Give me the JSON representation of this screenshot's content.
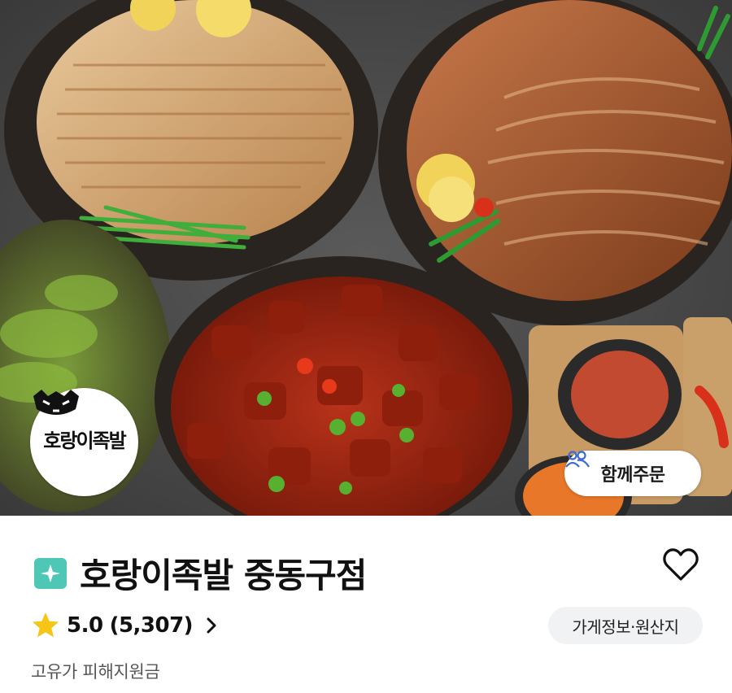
{
  "hero": {
    "logo_text": "호랑이족발",
    "group_order_label": "함께주문"
  },
  "store": {
    "name": "호랑이족발 중동구점",
    "rating": "5.0",
    "review_count": "(5,307)",
    "info_button_label": "가게정보·원산지",
    "subsidy_label": "고유가 피해지원금"
  },
  "icons": {
    "brand_mark": "sparkle-badge-icon",
    "favorite": "heart-icon",
    "rating": "star-icon",
    "rating_more": "chevron-right-icon",
    "group_order": "people-icon"
  },
  "colors": {
    "brand_mark": "#4fc7b7",
    "star": "#f5c518",
    "group_icon": "#3d6bd6",
    "pill_bg": "#f1f2f4"
  }
}
